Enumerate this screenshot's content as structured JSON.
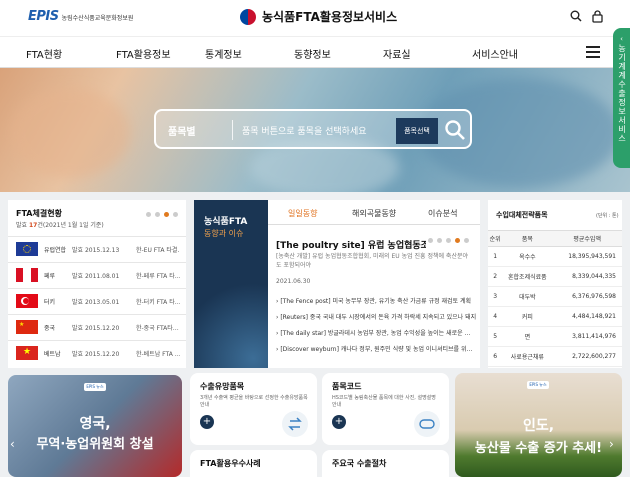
{
  "header": {
    "logo_text": "EPIS",
    "logo_org": "농림수산식품교육문화정보원",
    "site_title": "농식품FTA활용정보서비스"
  },
  "nav": [
    "FTA현황",
    "FTA활용정보",
    "통계정보",
    "동향정보",
    "자료실",
    "서비스안내"
  ],
  "side_tab": "농기계계수출정보서비스",
  "search": {
    "category": "품목별",
    "placeholder": "품목 버튼으로 품목을 선택하세요",
    "select_button": "품목선택"
  },
  "fta_status": {
    "title": "FTA체결현황",
    "sub_prefix": "발효",
    "sub_count": "17",
    "sub_suffix": "건(2021년 1월 1일 기준)",
    "rows": [
      {
        "name": "유럽연합",
        "date": "발효 2015.12.13",
        "desc": "한-EU FTA 타결…",
        "flag": "eu"
      },
      {
        "name": "페루",
        "date": "발효 2011.08.01",
        "desc": "한-페루 FTA 타…",
        "flag": "peru"
      },
      {
        "name": "터키",
        "date": "발효 2013.05.01",
        "desc": "한-터키 FTA 타…",
        "flag": "turkey"
      },
      {
        "name": "중국",
        "date": "발효 2015.12.20",
        "desc": "한-중국 FTA타…",
        "flag": "china"
      },
      {
        "name": "베트남",
        "date": "발효 2015.12.20",
        "desc": "한-베트남 FTA …",
        "flag": "vietnam"
      }
    ]
  },
  "issue_box": {
    "line1": "농식품FTA",
    "line2": "동향과 이슈"
  },
  "news": {
    "tabs": [
      "일일동향",
      "해외곡물동향",
      "이슈분석"
    ],
    "active_tab": 0,
    "headline": "[The poultry site] 유럽 농업협동조합협…",
    "body": "[농축산 개발] 유럽 농업협동조합협회, 미래의 EU 농업 진흥 정책에 축산분야도 포함되어야",
    "date": "2021.06.30",
    "items": [
      "[The Fence post] 미국 농무부 장관, 유기농 축산 가금류 규정 재검토 계획",
      "[Reuters] 중국 국내 대두 시장에서의 돈육 가격 하락세 지속되고 있으나 돼지…",
      "[The daily star] 방글라데시 농업부 장관, 농업 수익성을 높이는 새로운 …",
      "[Discover weyburn] 캐나다 정부, 원주민 식량 및 농업 이니셔티브를 위…"
    ]
  },
  "import_table": {
    "title": "수입대체전략품목",
    "unit": "(단위 : 톤)",
    "headers": [
      "순위",
      "품목",
      "평균수입액"
    ],
    "rows": [
      [
        "1",
        "옥수수",
        "18,395,943,591"
      ],
      [
        "2",
        "혼합조제식료품",
        "8,339,044,335"
      ],
      [
        "3",
        "대두박",
        "6,376,976,598"
      ],
      [
        "4",
        "커피",
        "4,484,148,921"
      ],
      [
        "5",
        "면",
        "3,811,414,976"
      ],
      [
        "6",
        "사료용근채류",
        "2,722,600,277"
      ]
    ]
  },
  "banner_left": {
    "tag": "EPIS 뉴스",
    "line1": "영국,",
    "line2": "무역·농업위원회 창설"
  },
  "banner_right": {
    "tag": "EPIS 뉴스",
    "line1": "인도,",
    "line2": "농산물 수출 증가 추세!"
  },
  "cards": [
    {
      "title": "수출유망품목",
      "desc": "3개년 수출액 평균을 바탕으로 선정한 수출유망품목 안내"
    },
    {
      "title": "품목코드",
      "desc": "HS코드별 농림축산물 품목에 대한 사진, 설명설명 안내"
    },
    {
      "title": "FTA활용우수사례",
      "desc": ""
    },
    {
      "title": "주요국 수출절차",
      "desc": ""
    }
  ],
  "colors": {
    "brand_blue": "#1f5fae",
    "navy": "#1a3553",
    "accent_orange": "#e07a1f",
    "side_tab_green": "#2c9f6a"
  }
}
